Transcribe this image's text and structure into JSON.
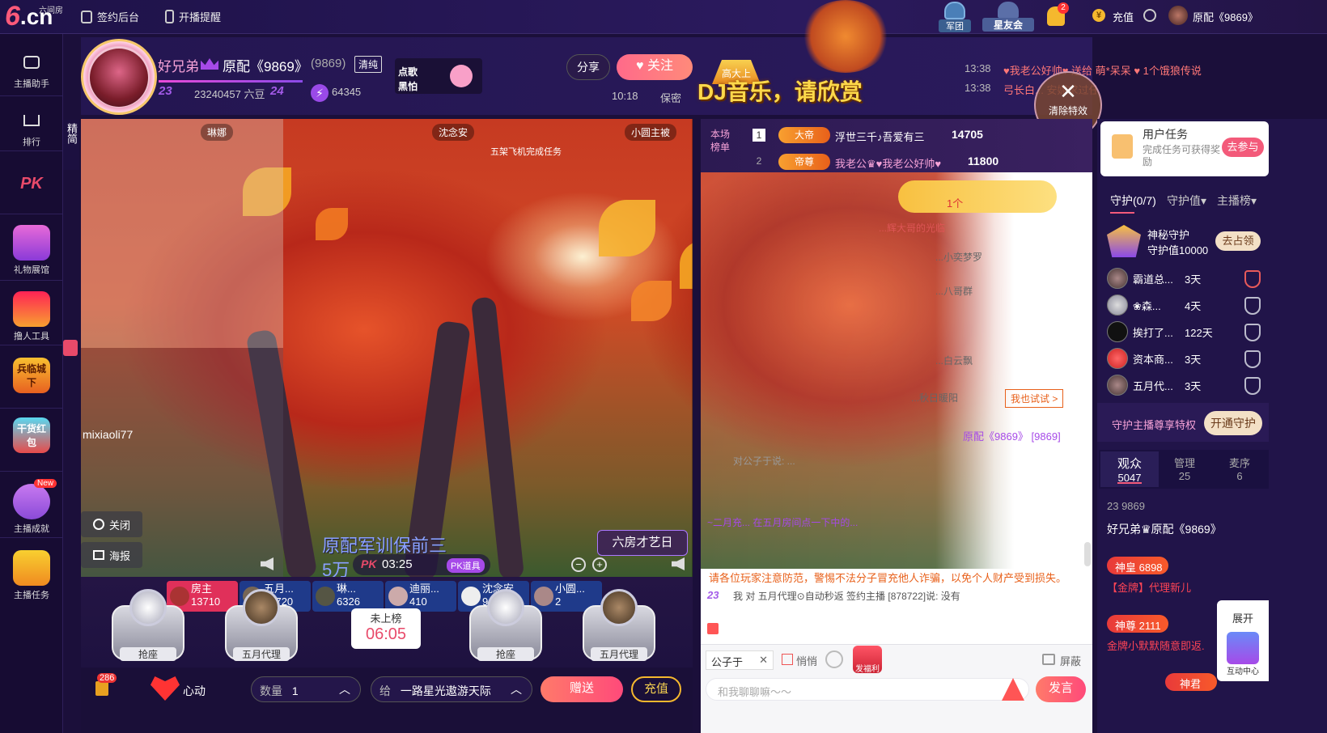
{
  "header": {
    "logo_six": "6",
    "logo_cn": ".cn",
    "logo_sub": "六间房",
    "sign_backend": "签约后台",
    "live_reminder": "开播提醒",
    "legion": "军团",
    "star_club": "星友会",
    "notify_count": "2",
    "recharge": "充值",
    "username": "原配《9869》"
  },
  "sidebar": [
    {
      "label": "主播助手"
    },
    {
      "label": "排行"
    },
    {
      "label": "PK"
    },
    {
      "label": "礼物展馆"
    },
    {
      "label": "撸人工具"
    },
    {
      "label": "兵临城下"
    },
    {
      "label": "干货红包"
    },
    {
      "label": "主播成就",
      "badge": "New"
    },
    {
      "label": "主播任务"
    }
  ],
  "anchor": {
    "name": "好兄弟",
    "title": "原配《9869》",
    "room_id": "(9869)",
    "tag": "清纯",
    "level_a": "23",
    "coins": "23240457 六豆",
    "level_b": "24",
    "fans": "64345",
    "song_label_1": "点歌",
    "song_label_2": "黑怕",
    "share": "分享",
    "follow": "关注",
    "time": "10:18",
    "privacy": "保密",
    "dj_banner": "DJ音乐，请欣赏",
    "gao_tag": "高大上"
  },
  "marquee": [
    {
      "time": "13:38",
      "text": "♥我老公好帅♥ 送给 萌*呆呆 ♥ 1个饿狼传说"
    },
    {
      "time": "13:38",
      "text": "弓长白... 安妮求过任务 1个九黎·蚩尤"
    }
  ],
  "clear_fx": "清除特效",
  "stage": {
    "side_tab": "精简",
    "cam_names": [
      "琳娜",
      "沈念安",
      "小圆主被"
    ],
    "task_text": "五架飞机完成任务",
    "guest_name": "mixiaoli77",
    "close_btn": "关闭",
    "poster_btn": "海报",
    "subtitle_1": "原配军训保前三",
    "subtitle_2": "5万",
    "pk_time": "03:25",
    "pk_tool": "PK道具",
    "room_tag": "六房才艺日"
  },
  "ranking": [
    {
      "name": "房主",
      "score": "13710",
      "color": "#e0305a"
    },
    {
      "name": "五月...",
      "score": "12720",
      "color": "#1f3a8a"
    },
    {
      "name": "琳...",
      "score": "6326",
      "color": "#1f3a8a"
    },
    {
      "name": "迪丽...",
      "score": "410",
      "color": "#1f3a8a"
    },
    {
      "name": "沈念安",
      "score": "9",
      "color": "#1f3a8a"
    },
    {
      "name": "小圆...",
      "score": "2",
      "color": "#1f3a8a"
    }
  ],
  "seats": [
    {
      "label": "抢座"
    },
    {
      "label": "五月代理"
    },
    {
      "label": "抢座"
    },
    {
      "label": "五月代理"
    }
  ],
  "timer": {
    "label": "未上榜",
    "value": "06:05"
  },
  "bottom": {
    "heart_count": "286",
    "heart_label": "心动",
    "qty_label": "数量",
    "qty_value": "1",
    "give_label": "给",
    "give_target": "一路星光遨游天际",
    "send": "赠送",
    "recharge": "充值"
  },
  "room_rank": {
    "title_1": "本场",
    "title_2": "榜单",
    "rows": [
      {
        "rank": "1",
        "badge": "大帝",
        "name": "浮世三千♪吾爱有三",
        "score": "14705"
      },
      {
        "rank": "2",
        "badge": "帝尊",
        "name": "我老公♛♥我老公好帅♥",
        "score": "11800"
      }
    ]
  },
  "chat": {
    "gift_banner": "1个",
    "msgs": [
      {
        "text": "...辉大哥的光临"
      },
      {
        "text": "...小奕梦罗"
      },
      {
        "text": "...八哥群"
      },
      {
        "text": "...白云飘"
      },
      {
        "text": "...秋日暖阳"
      },
      {
        "text": "原配《9869》 [9869]"
      },
      {
        "text": "对公子于说: ..."
      },
      {
        "text": "~二月充... 在五月房间点一下中的..."
      }
    ],
    "try_btn": "我也试试 >",
    "warning": "请各位玩家注意防范，警惕不法分子冒充他人诈骗，以免个人财产受到损失。",
    "last_line": "我 对 五月代理⊙自动秒返 签约主播 [878722]说: 没有",
    "last_level": "23",
    "target": "公子于",
    "whisper": "悄悄",
    "block": "屏蔽",
    "placeholder": "和我聊聊嘛～～",
    "send": "发言",
    "red_packet": "发福利"
  },
  "right": {
    "task_title": "用户任务",
    "task_desc": "完成任务可获得奖励",
    "task_btn": "去参与",
    "tabs": [
      "守护(0/7)",
      "守护值▾",
      "主播榜▾"
    ],
    "mystery": "神秘守护",
    "guard_value": "守护值10000",
    "occupy": "去占领",
    "guards": [
      {
        "name": "霸道总...",
        "days": "3天"
      },
      {
        "name": "❀森...",
        "days": "4天"
      },
      {
        "name": "挨打了...",
        "days": "122天"
      },
      {
        "name": "资本商...",
        "days": "3天"
      },
      {
        "name": "五月代...",
        "days": "3天"
      }
    ],
    "privilege": "守护主播尊享特权",
    "open_guard": "开通守护",
    "aud_tabs": [
      {
        "label": "观众",
        "count": "5047"
      },
      {
        "label": "管理",
        "count": "25"
      },
      {
        "label": "麦序",
        "count": "6"
      }
    ],
    "viewers": [
      {
        "line1": "23 9869",
        "line2": "好兄弟♛原配《9869》"
      },
      {
        "line1": "神皇  6898",
        "line2": "【金牌】代理新儿"
      },
      {
        "line1": "神尊  2111",
        "line2": "金牌小默默随意即返."
      },
      {
        "line1": "神君",
        "line2": ""
      }
    ],
    "expand": "展开",
    "interact": "互动中心"
  }
}
